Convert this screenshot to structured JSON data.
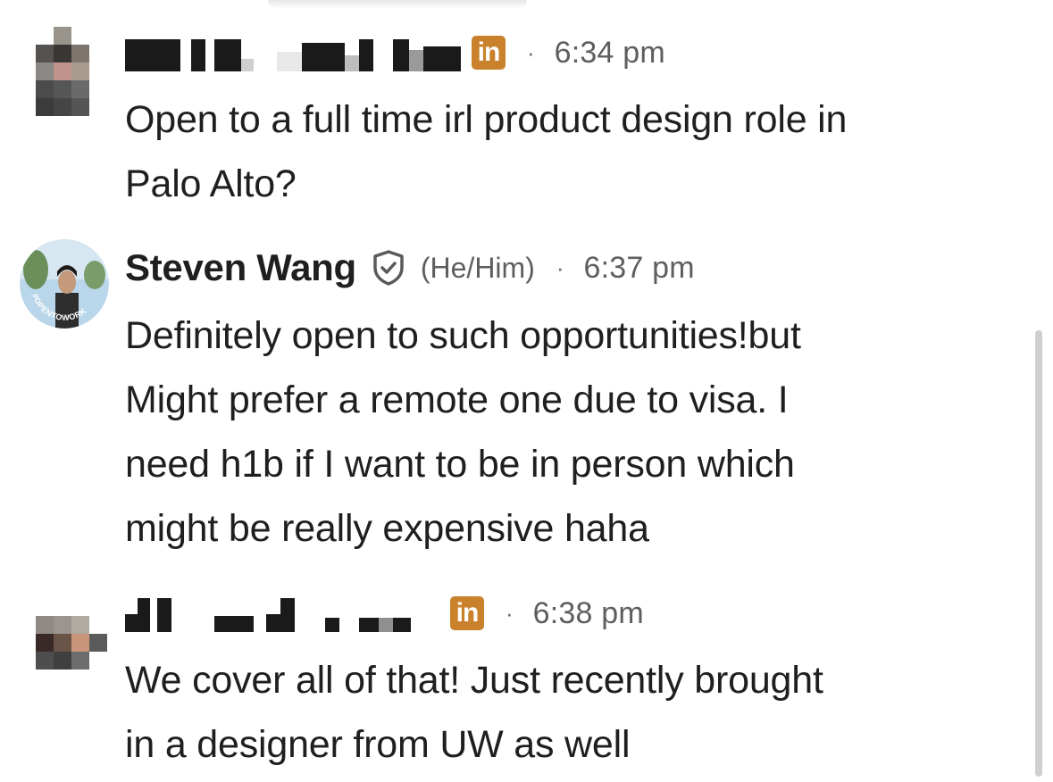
{
  "messages": [
    {
      "sender_name": "",
      "sender_name_redacted": true,
      "badge": "in",
      "separator": "·",
      "time": "6:34 pm",
      "lines": [
        "Open to a full time irl product design role in",
        "Palo Alto?"
      ]
    },
    {
      "sender_name": "Steven Wang",
      "verified_icon": "shield-check-icon",
      "pronouns": "(He/Him)",
      "separator": "·",
      "time": "6:37 pm",
      "avatar_ring_text": "#OPENTOWORK",
      "lines": [
        "Definitely open to such opportunities!but",
        "Might prefer a remote one due to visa. I",
        "need h1b if I want to be in person which",
        "might be really expensive haha"
      ]
    },
    {
      "sender_name": "",
      "sender_name_redacted": true,
      "badge": "in",
      "separator": "·",
      "time": "6:38 pm",
      "lines": [
        "We cover all of that! Just recently brought",
        "in a designer from UW as well"
      ]
    }
  ],
  "colors": {
    "linkedin_badge": "#c9822b",
    "open_to_work_ring": "#3f7d3a",
    "text": "#1f1f1f",
    "meta_text": "#5e5e5e"
  }
}
